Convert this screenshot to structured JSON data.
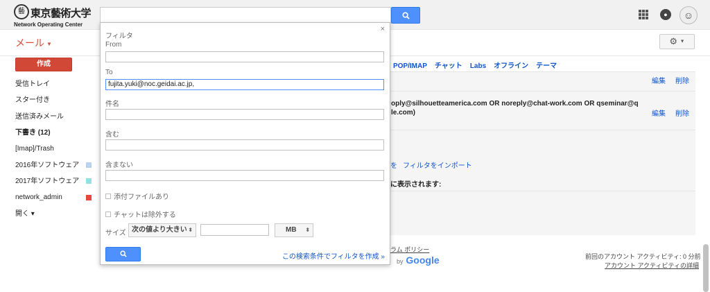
{
  "logo": {
    "seal": "藝",
    "name_jp": "東京藝術大学",
    "name_en": "Network Operating Center"
  },
  "header": {
    "search_icon": "search-icon",
    "apps_icon": "apps-grid-icon",
    "notification_icon": "notification-icon",
    "avatar_icon": "avatar"
  },
  "app_label": "メール",
  "compose_label": "作成",
  "nav": [
    {
      "label": "受信トレイ",
      "bold": false,
      "color": ""
    },
    {
      "label": "スター付き",
      "bold": false,
      "color": ""
    },
    {
      "label": "送信済みメール",
      "bold": false,
      "color": ""
    },
    {
      "label": "下書き (12)",
      "bold": true,
      "color": ""
    },
    {
      "label": "[Imap]/Trash",
      "bold": false,
      "color": ""
    },
    {
      "label": "2016年ソフトウェア",
      "bold": false,
      "color": "#b9d3ee"
    },
    {
      "label": "2017年ソフトウェア",
      "bold": false,
      "color": "#93e2e2"
    },
    {
      "label": "network_admin",
      "bold": false,
      "color": "#e8453c"
    },
    {
      "label": "開く ▾",
      "bold": false,
      "color": ""
    }
  ],
  "settings_tabs": [
    "POP/IMAP",
    "チャット",
    "Labs",
    "オフライン",
    "テーマ"
  ],
  "filters": {
    "edit": "編集",
    "delete": "削除",
    "row2_line1": "oply@silhouetteamerica.com OR noreply@chat-work.com OR qseminar@q",
    "row2_line2": "le.com)",
    "create_mark": "を",
    "import": "フィルタをインポート",
    "shown_text": "に表示されます:"
  },
  "footer": {
    "policy": "ラム ポリシー",
    "powered_by": "by",
    "google": "Google",
    "activity": "前回のアカウント アクティビティ: 0 分前",
    "activity_detail": "アカウント アクティビティの詳細"
  },
  "filter_popup": {
    "title": "フィルタ",
    "close": "×",
    "from_label": "From",
    "from_value": "",
    "to_label": "To",
    "to_value": "fujita.yuki@noc.geidai.ac.jp,",
    "subject_label": "件名",
    "subject_value": "",
    "has_label": "含む",
    "has_value": "",
    "not_label": "含まない",
    "not_value": "",
    "attachment_label": "添付ファイルあり",
    "no_chat_label": "チャットは除外する",
    "size_label": "サイズ",
    "size_op": "次の値より大きい",
    "size_value": "",
    "size_unit": "MB",
    "create_link": "この検索条件でフィルタを作成 »"
  }
}
